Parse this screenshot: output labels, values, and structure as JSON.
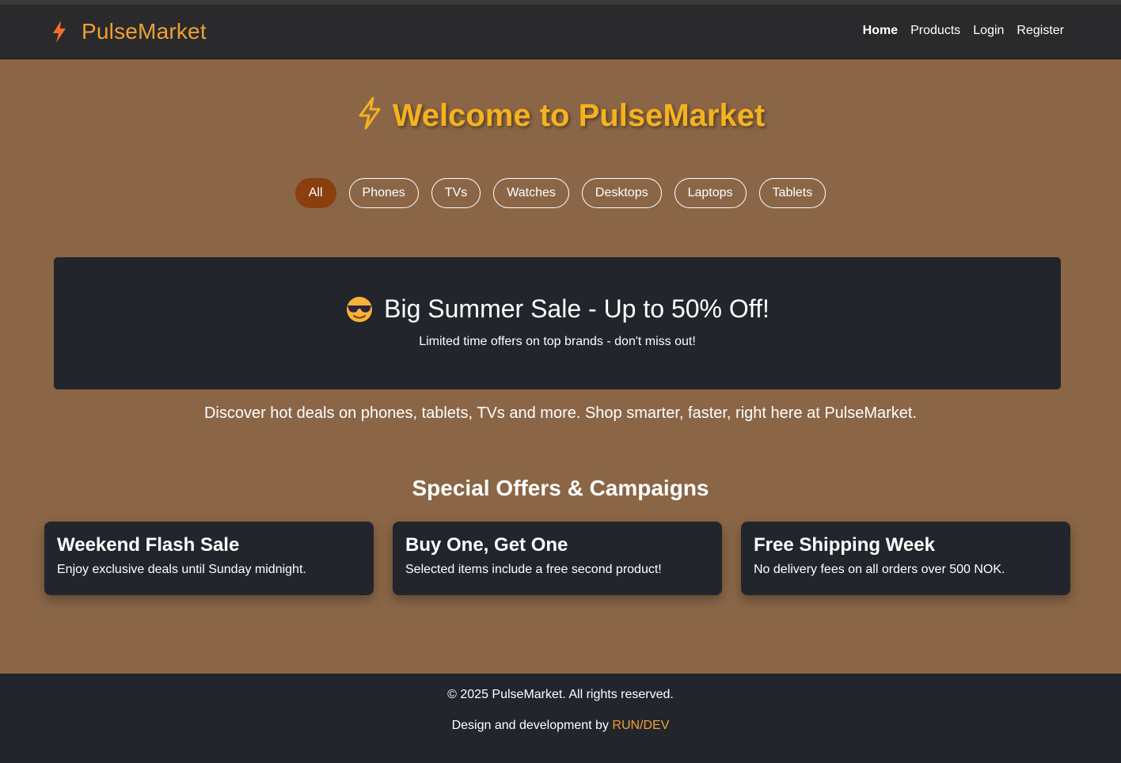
{
  "header": {
    "brand": "PulseMarket",
    "brand_icon": "bolt-icon",
    "nav": [
      {
        "label": "Home",
        "active": true
      },
      {
        "label": "Products"
      },
      {
        "label": "Login"
      },
      {
        "label": "Register"
      }
    ]
  },
  "hero": {
    "title": "Welcome to PulseMarket",
    "icon": "bolt-icon"
  },
  "filters": [
    "All",
    "Phones",
    "TVs",
    "Watches",
    "Desktops",
    "Laptops",
    "Tablets"
  ],
  "active_filter": "All",
  "banner": {
    "icon": "smiling-face-with-sunglasses-icon",
    "title": "Big Summer Sale - Up to 50% Off!",
    "subtitle": "Limited time offers on top brands - don't miss out!"
  },
  "tagline": "Discover hot deals on phones, tablets, TVs and more. Shop smarter, faster, right here at PulseMarket.",
  "offers": {
    "title": "Special Offers & Campaigns",
    "items": [
      {
        "title": "Weekend Flash Sale",
        "desc": "Enjoy exclusive deals until Sunday midnight."
      },
      {
        "title": "Buy One, Get One",
        "desc": "Selected items include a free second product!"
      },
      {
        "title": "Free Shipping Week",
        "desc": "No delivery fees on all orders over 500 NOK."
      }
    ]
  },
  "footer": {
    "copyright": "© 2025 PulseMarket. All rights reserved.",
    "credit_prefix": "Design and development by",
    "credit_link": "RUN/DEV"
  },
  "colors": {
    "accent": "#f0a030",
    "hero_title": "#f5b21f",
    "page_bg": "#8a6647",
    "dark_bg": "#22252b",
    "active_pill": "#8b3e0e"
  }
}
